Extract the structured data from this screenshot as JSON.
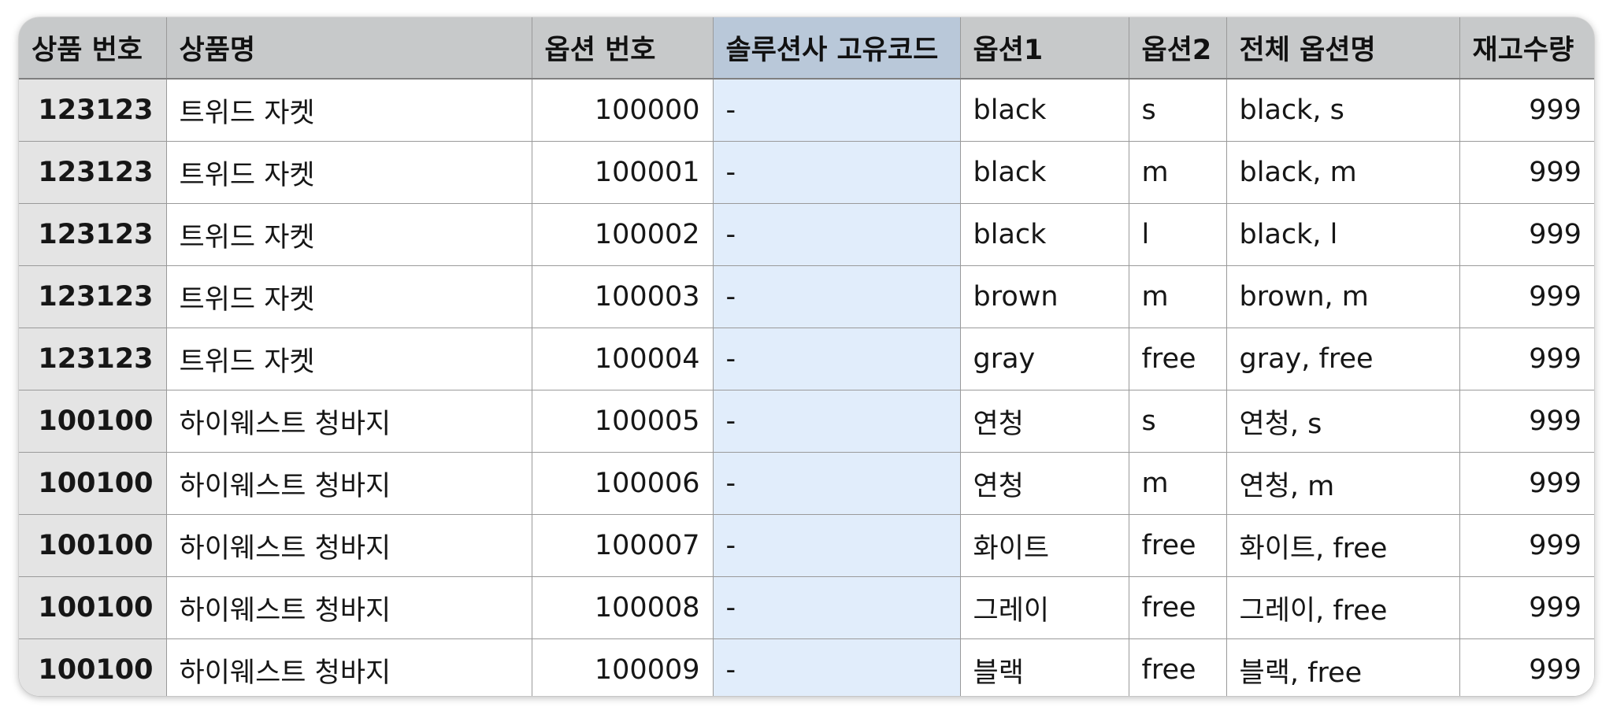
{
  "table": {
    "headers": [
      "상품 번호",
      "상품명",
      "옵션 번호",
      "솔루션사 고유코드",
      "옵션1",
      "옵션2",
      "전체 옵션명",
      "재고수량"
    ],
    "rows": [
      [
        "123123",
        "트위드 자켓",
        "100000",
        "-",
        "black",
        "s",
        "black, s",
        "999"
      ],
      [
        "123123",
        "트위드 자켓",
        "100001",
        "-",
        "black",
        "m",
        "black, m",
        "999"
      ],
      [
        "123123",
        "트위드 자켓",
        "100002",
        "-",
        "black",
        "l",
        "black, l",
        "999"
      ],
      [
        "123123",
        "트위드 자켓",
        "100003",
        "-",
        "brown",
        "m",
        "brown, m",
        "999"
      ],
      [
        "123123",
        "트위드 자켓",
        "100004",
        "-",
        "gray",
        "free",
        "gray, free",
        "999"
      ],
      [
        "100100",
        "하이웨스트 청바지",
        "100005",
        "-",
        "연청",
        "s",
        "연청, s",
        "999"
      ],
      [
        "100100",
        "하이웨스트 청바지",
        "100006",
        "-",
        "연청",
        "m",
        "연청, m",
        "999"
      ],
      [
        "100100",
        "하이웨스트 청바지",
        "100007",
        "-",
        "화이트",
        "free",
        "화이트, free",
        "999"
      ],
      [
        "100100",
        "하이웨스트 청바지",
        "100008",
        "-",
        "그레이",
        "free",
        "그레이, free",
        "999"
      ],
      [
        "100100",
        "하이웨스트 청바지",
        "100009",
        "-",
        "블랙",
        "free",
        "블랙, free",
        "999"
      ]
    ]
  },
  "colors": {
    "header_bg": "#c7c9ca",
    "selected_header_bg": "#b9c8d9",
    "selected_column_bg": "#e1edfb",
    "row_header_bg": "#e4e4e4",
    "grid_line": "#9a9a9a"
  }
}
